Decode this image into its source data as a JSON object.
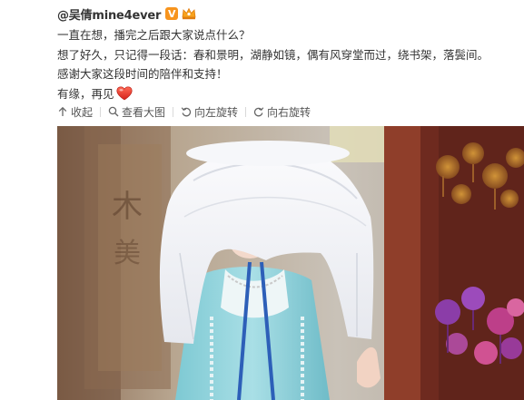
{
  "post": {
    "author": "@吴倩mine4ever",
    "verified_badge": "V",
    "lines": [
      "一直在想，播完之后跟大家说点什么？",
      "想了好久，只记得一段话：春和景明，湖静如镜，偶有风穿堂而过，绕书架，落鬓间。",
      "感谢大家这段时间的陪伴和支持！",
      "有缘，再见"
    ],
    "emoji": "heart"
  },
  "toolbar": {
    "collapse": "收起",
    "view_large": "查看大图",
    "rotate_left": "向左旋转",
    "rotate_right": "向右旋转"
  },
  "icons": {
    "collapse": "arrow-up-icon",
    "view_large": "magnifier-icon",
    "rotate_left": "rotate-left-icon",
    "rotate_right": "rotate-right-icon"
  },
  "colors": {
    "author_text": "#333333",
    "verified_badge": "#f7941d",
    "heart": "#e8372b",
    "toolbar_text": "#555555"
  }
}
